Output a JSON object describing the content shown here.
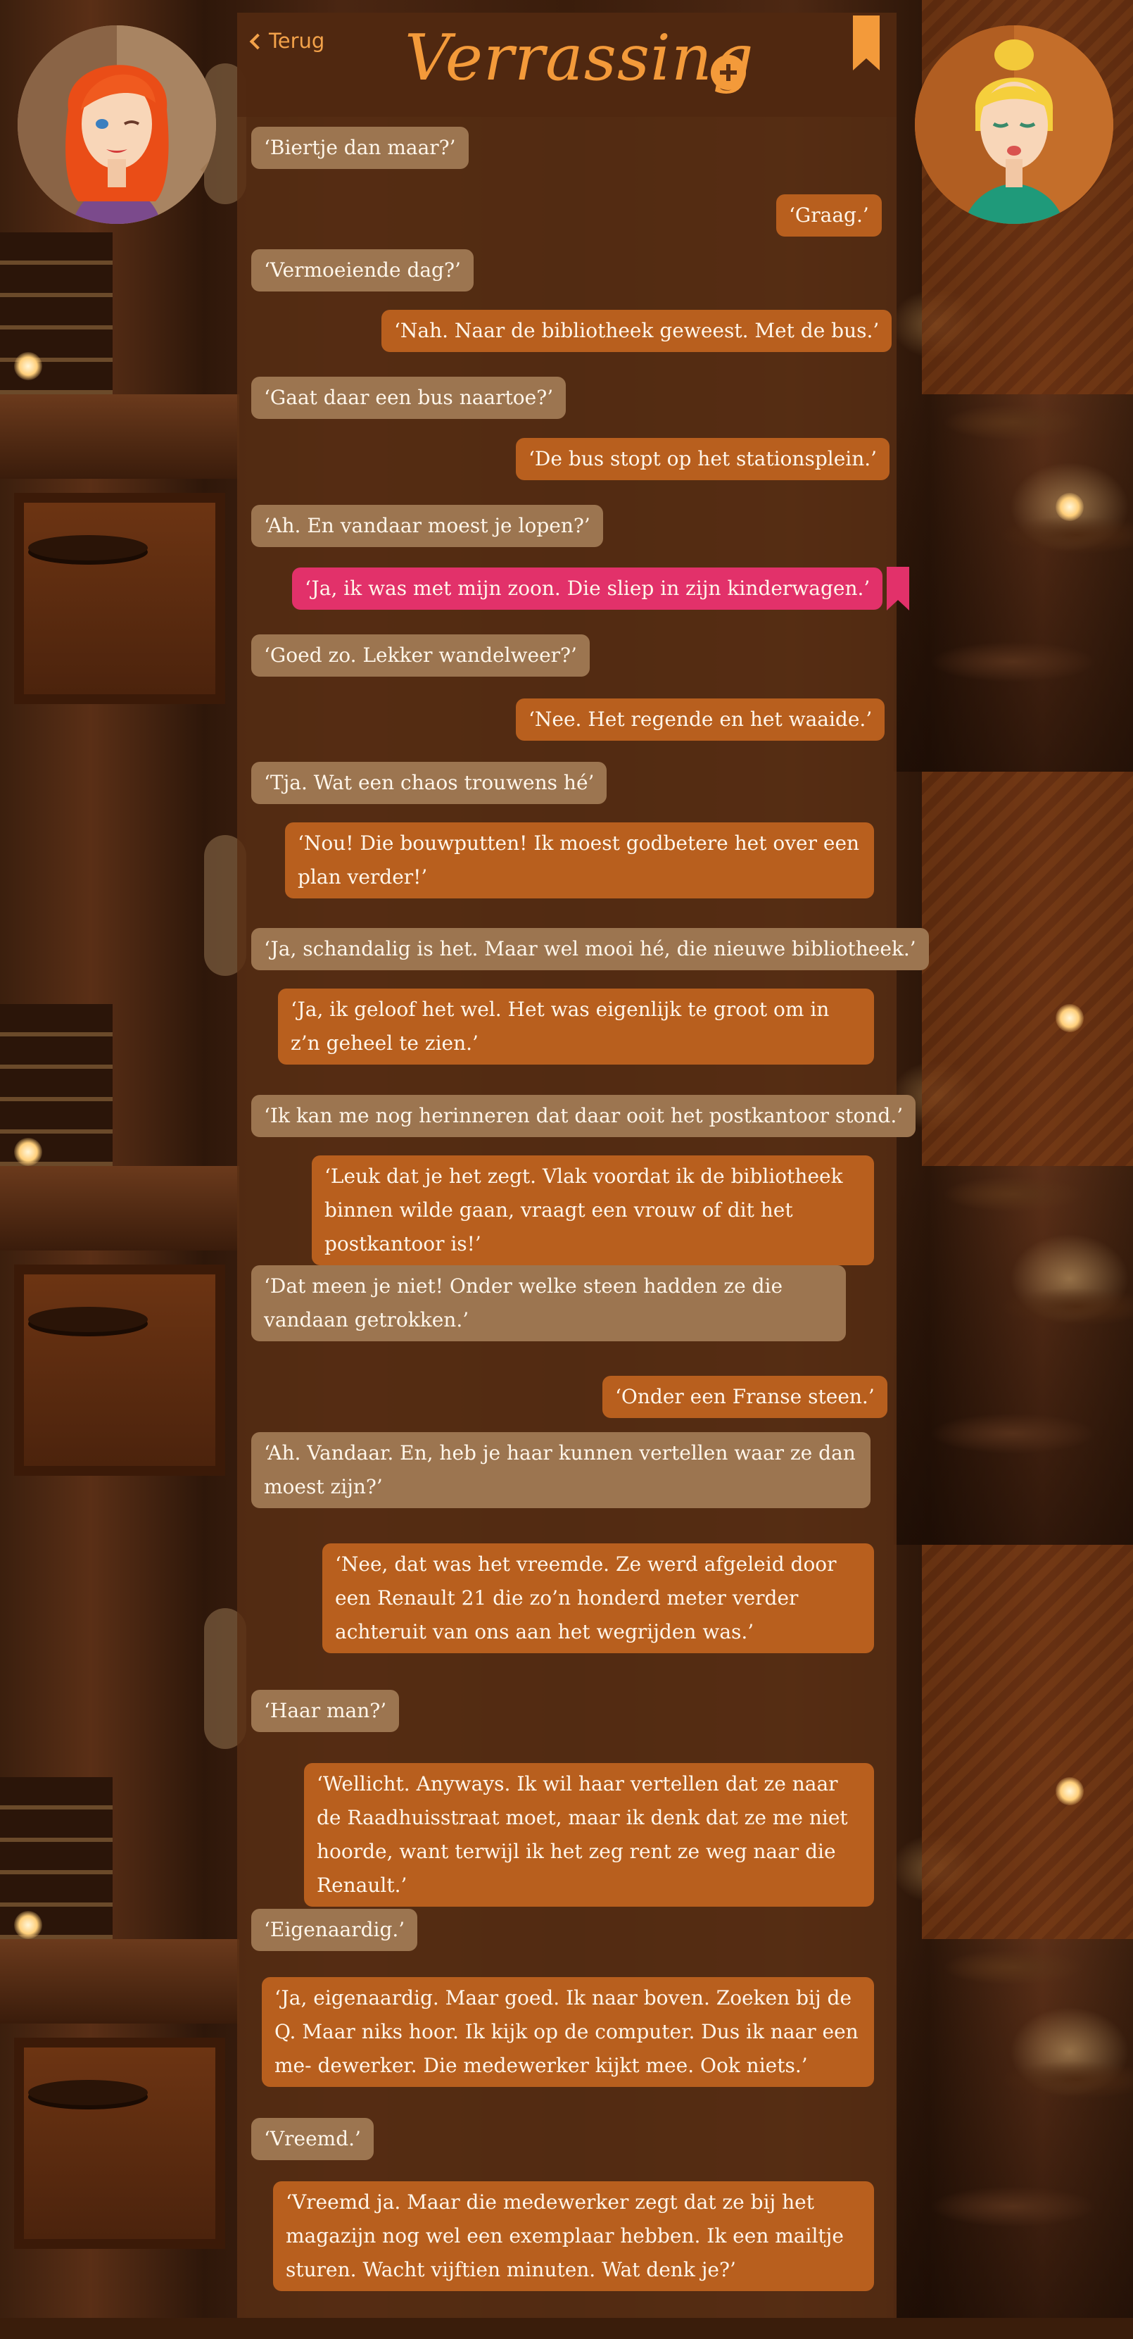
{
  "header": {
    "back_label": "Terug",
    "title": "Verrassing"
  },
  "colors": {
    "accent": "#f39a3a",
    "bubble_them": "#9c7550",
    "bubble_me": "#b85f1e",
    "bubble_highlight": "#e2316a"
  },
  "messages": [
    {
      "text": "‘Biertje dan maar?’"
    },
    {
      "text": "‘Graag.’"
    },
    {
      "text": "‘Vermoeiende dag?’"
    },
    {
      "text": "‘Nah. Naar de bibliotheek geweest. Met de bus.’"
    },
    {
      "text": "‘Gaat daar een bus naartoe?’"
    },
    {
      "text": "‘De bus stopt op het stationsplein.’"
    },
    {
      "text": "‘Ah. En vandaar moest je lopen?’"
    },
    {
      "text": "‘Ja, ik was met mijn zoon. Die sliep in zijn kinderwagen.’"
    },
    {
      "text": "‘Goed zo. Lekker wandelweer?’"
    },
    {
      "text": "‘Nee. Het regende en het waaide.’"
    },
    {
      "text": "‘Tja. Wat een chaos trouwens hé’"
    },
    {
      "text": "‘Nou! Die bouwputten! Ik moest godbetere het over een plan verder!’"
    },
    {
      "text": "‘Ja, schandalig is het. Maar wel mooi hé, die nieuwe bibliotheek.’"
    },
    {
      "text": "‘Ja, ik geloof het wel. Het was eigenlijk te groot om in z’n geheel te zien.’"
    },
    {
      "text": "‘Ik kan me nog herinneren dat daar ooit het postkantoor stond.’"
    },
    {
      "text": "‘Leuk dat je het zegt. Vlak voordat ik de bibliotheek binnen wilde gaan, vraagt een vrouw of dit het postkantoor is!’"
    },
    {
      "text": "‘Dat meen je niet! Onder welke steen hadden ze die vandaan getrokken.’"
    },
    {
      "text": "‘Onder een Franse steen.’"
    },
    {
      "text": "‘Ah. Vandaar. En, heb je haar kunnen vertellen waar ze dan moest zijn?’"
    },
    {
      "text": "‘Nee, dat was het vreemde. Ze werd afgeleid door een Renault 21 die zo’n honderd meter verder achteruit van ons aan het wegrijden was.’"
    },
    {
      "text": "‘Haar man?’"
    },
    {
      "text": "‘Wellicht. Anyways. Ik wil haar vertellen dat ze naar de Raadhuisstraat moet, maar ik denk dat ze me niet hoorde, want terwijl ik het zeg rent ze weg naar die Renault.’"
    },
    {
      "text": "‘Eigenaardig.’"
    },
    {
      "text": "‘Ja, eigenaardig. Maar goed. Ik naar boven. Zoeken bij de Q. Maar niks hoor. Ik kijk op de computer. Dus ik naar een me- dewerker. Die medewerker kijkt mee. Ook niets.’"
    },
    {
      "text": "‘Vreemd.’"
    },
    {
      "text": "‘Vreemd ja. Maar die medewerker zegt dat ze bij het magazijn nog wel een exemplaar hebben. Ik een mailtje sturen. Wacht vijftien minuten. Wat denk je?’"
    }
  ]
}
